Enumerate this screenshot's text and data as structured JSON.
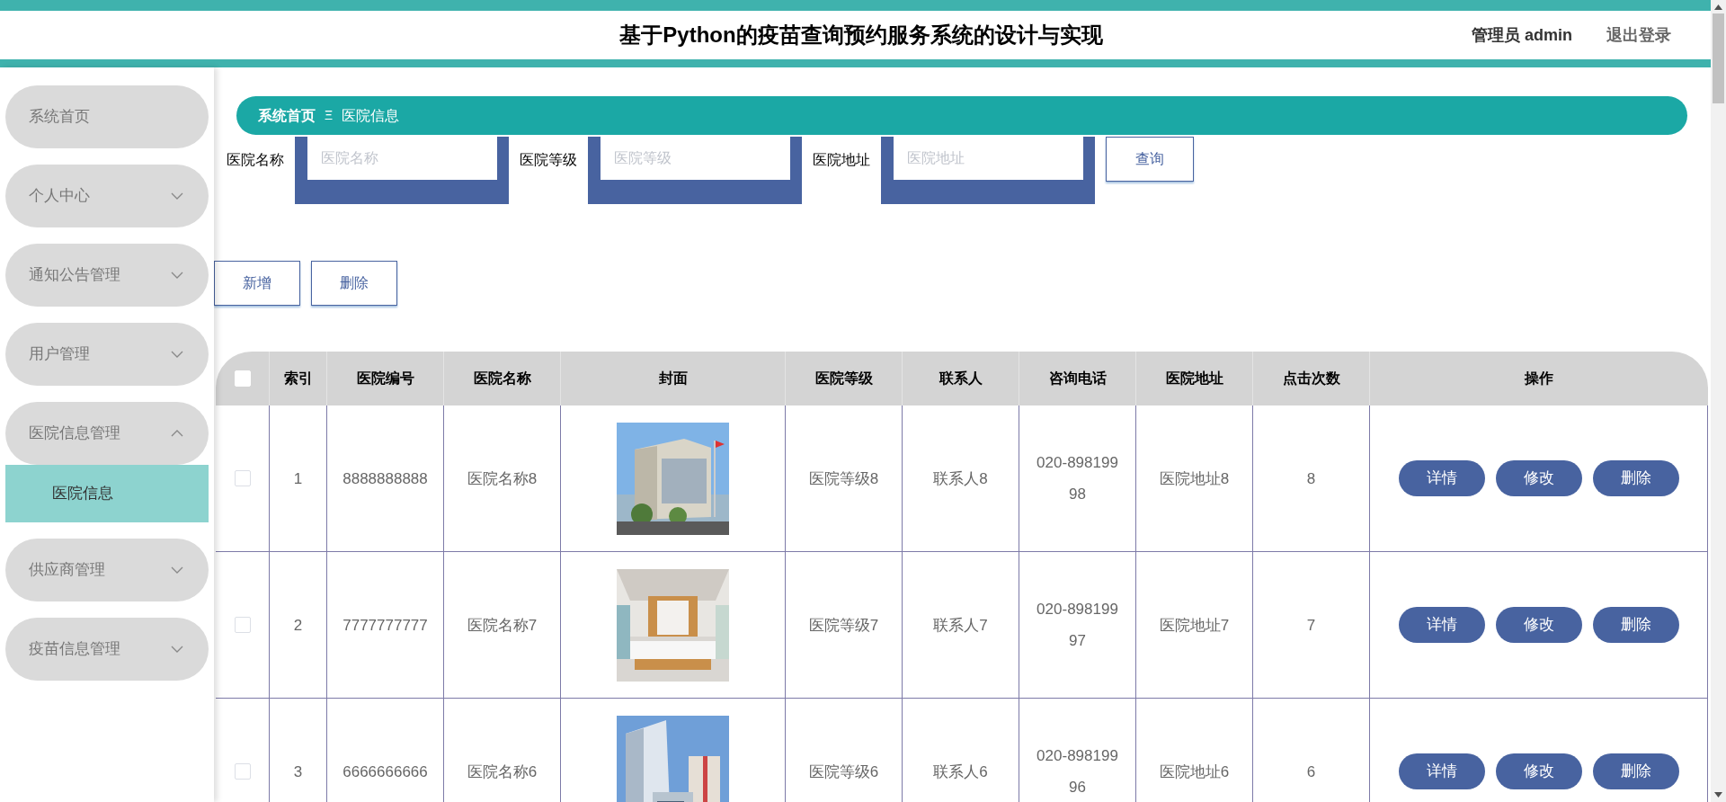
{
  "header": {
    "title": "基于Python的疫苗查询预约服务系统的设计与实现",
    "user": "管理员 admin",
    "logout": "退出登录"
  },
  "sidebar": {
    "items": [
      {
        "label": "系统首页",
        "kind": "link"
      },
      {
        "label": "个人中心",
        "kind": "menu",
        "expanded": false
      },
      {
        "label": "通知公告管理",
        "kind": "menu",
        "expanded": false
      },
      {
        "label": "用户管理",
        "kind": "menu",
        "expanded": false
      },
      {
        "label": "医院信息管理",
        "kind": "menu",
        "expanded": true,
        "children": [
          {
            "label": "医院信息",
            "selected": true
          }
        ]
      },
      {
        "label": "供应商管理",
        "kind": "menu",
        "expanded": false
      },
      {
        "label": "疫苗信息管理",
        "kind": "menu",
        "expanded": false
      }
    ]
  },
  "breadcrumb": {
    "home": "系统首页",
    "separator": "Ξ",
    "current": "医院信息"
  },
  "search": {
    "fields": [
      {
        "label": "医院名称",
        "placeholder": "医院名称"
      },
      {
        "label": "医院等级",
        "placeholder": "医院等级"
      },
      {
        "label": "医院地址",
        "placeholder": "医院地址"
      }
    ],
    "button": "查询"
  },
  "actions": [
    "新增",
    "删除"
  ],
  "table": {
    "select_all": {
      "checked": false
    },
    "columns": [
      "索引",
      "医院编号",
      "医院名称",
      "封面",
      "医院等级",
      "联系人",
      "咨询电话",
      "医院地址",
      "点击次数",
      "操作"
    ],
    "rows": [
      {
        "checked": false,
        "index": "1",
        "code": "8888888888",
        "name": "医院名称8",
        "grade": "医院等级8",
        "contact": "联系人8",
        "phone": "020-89819998",
        "address": "医院地址8",
        "clicks": "8",
        "buttons": [
          "详情",
          "修改",
          "删除"
        ]
      },
      {
        "checked": false,
        "index": "2",
        "code": "7777777777",
        "name": "医院名称7",
        "grade": "医院等级7",
        "contact": "联系人7",
        "phone": "020-89819997",
        "address": "医院地址7",
        "clicks": "7",
        "buttons": [
          "详情",
          "修改",
          "删除"
        ]
      },
      {
        "checked": false,
        "index": "3",
        "code": "6666666666",
        "name": "医院名称6",
        "grade": "医院等级6",
        "contact": "联系人6",
        "phone": "020-89819996",
        "address": "医院地址6",
        "clicks": "6",
        "buttons": [
          "详情",
          "修改",
          "删除"
        ]
      }
    ]
  }
}
